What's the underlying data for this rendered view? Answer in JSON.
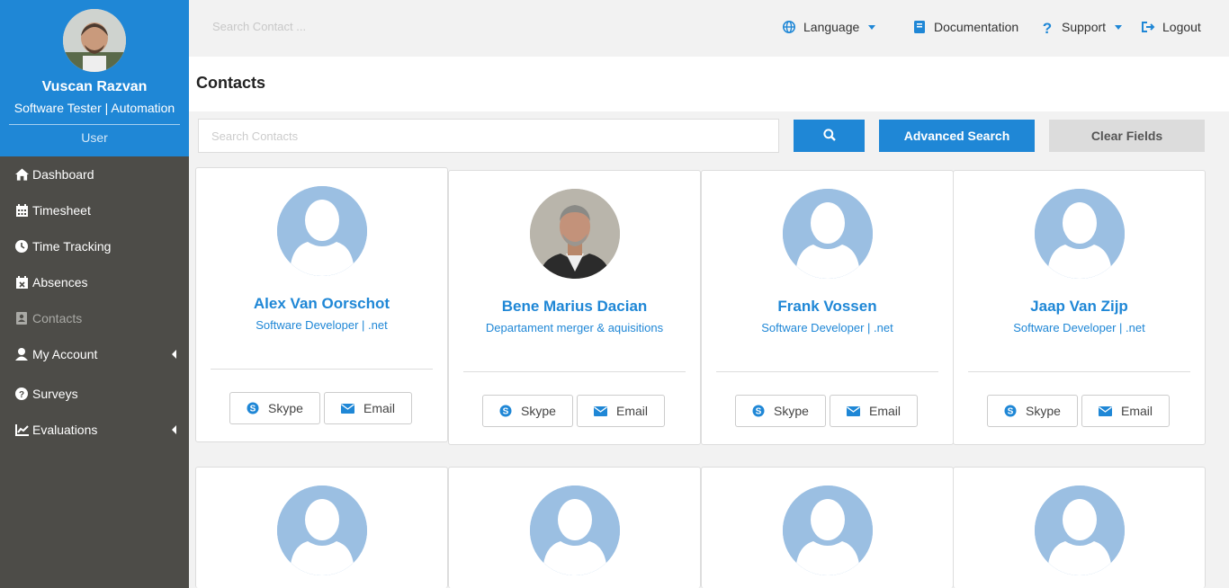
{
  "user": {
    "name": "Vuscan Razvan",
    "role": "Software Tester | Automation",
    "type": "User"
  },
  "sidebar": {
    "items": [
      {
        "label": "Dashboard",
        "icon": "home-icon"
      },
      {
        "label": "Timesheet",
        "icon": "calendar-icon"
      },
      {
        "label": "Time Tracking",
        "icon": "clock-icon"
      },
      {
        "label": "Absences",
        "icon": "calendar-x-icon"
      },
      {
        "label": "Contacts",
        "icon": "contact-card-icon",
        "active": true
      },
      {
        "label": "My Account",
        "icon": "user-icon",
        "expandable": true
      },
      {
        "label": "Surveys",
        "icon": "question-circle-icon"
      },
      {
        "label": "Evaluations",
        "icon": "line-chart-icon",
        "expandable": true
      }
    ]
  },
  "topbar": {
    "search_placeholder": "Search Contact ...",
    "language": "Language",
    "documentation": "Documentation",
    "support": "Support",
    "logout": "Logout"
  },
  "page": {
    "title": "Contacts"
  },
  "search": {
    "placeholder": "Search Contacts",
    "advanced_label": "Advanced Search",
    "clear_label": "Clear Fields"
  },
  "contacts": [
    {
      "name": "Alex Van Oorschot",
      "role": "Software Developer | .net",
      "skype": "Skype",
      "email": "Email"
    },
    {
      "name": "Bene Marius Dacian",
      "role": "Departament merger & aquisitions",
      "skype": "Skype",
      "email": "Email"
    },
    {
      "name": "Frank Vossen",
      "role": "Software Developer | .net",
      "skype": "Skype",
      "email": "Email"
    },
    {
      "name": "Jaap Van Zijp",
      "role": "Software Developer | .net",
      "skype": "Skype",
      "email": "Email"
    }
  ],
  "colors": {
    "primary": "#1f87d6",
    "sidebar": "#4d4c48",
    "avatar_placeholder": "#9bbfe2"
  }
}
